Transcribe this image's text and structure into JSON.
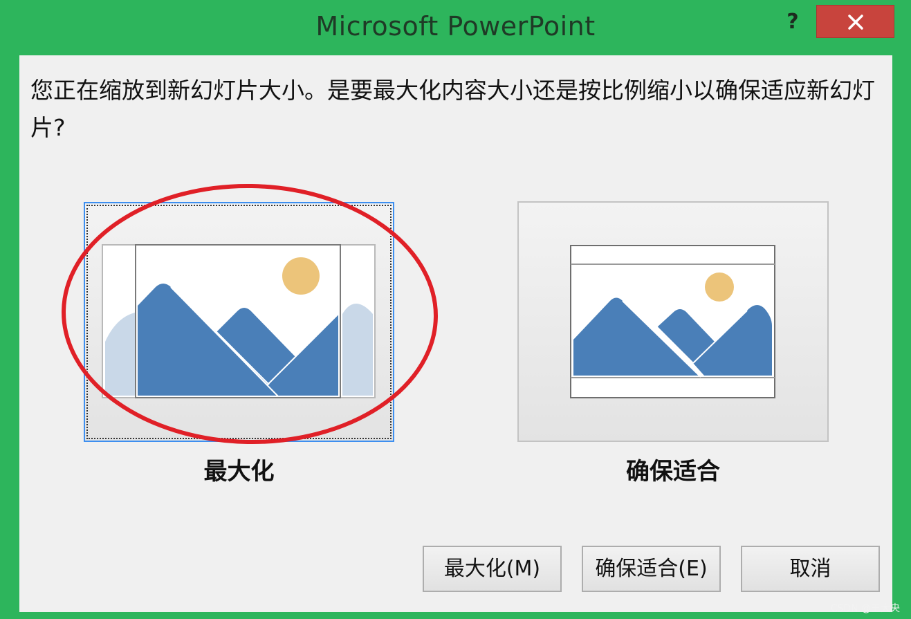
{
  "window": {
    "title": "Microsoft PowerPoint",
    "help_label": "?",
    "close_icon": "close-icon"
  },
  "message": "您正在缩放到新幻灯片大小。是要最大化内容大小还是按比例缩小以确保适应新幻灯片?",
  "options": {
    "maximize": {
      "label": "最大化",
      "icon": "maximize-preview-icon"
    },
    "fit": {
      "label": "确保适合",
      "icon": "ensure-fit-preview-icon"
    }
  },
  "buttons": {
    "maximize": "最大化(M)",
    "fit": "确保适合(E)",
    "cancel": "取消"
  },
  "watermark": "CSDN @王大央",
  "colors": {
    "titlebar": "#2db55c",
    "close": "#c8443d",
    "mountain": "#4a7fb8",
    "mountain_faded": "#c9d8e8",
    "sun": "#ecc47a",
    "annotation": "#e02027",
    "focus": "#3d8ff0"
  }
}
